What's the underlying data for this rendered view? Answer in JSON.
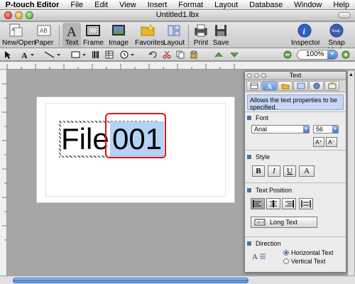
{
  "menubar": {
    "apple_glyph": "",
    "items": [
      "P-touch Editor",
      "File",
      "Edit",
      "View",
      "Insert",
      "Format",
      "Layout",
      "Database",
      "Window",
      "Help"
    ]
  },
  "window": {
    "title": "Untitled1.lbx"
  },
  "toolbar": {
    "new_open": "New/Open",
    "paper": "Paper",
    "text": "Text",
    "frame": "Frame",
    "image": "Image",
    "favorites": "Favorites",
    "layout": "Layout",
    "print": "Print",
    "save": "Save",
    "inspector": "Inspector",
    "snap_mode": "Snap Mode",
    "selected_tool": "Text"
  },
  "secondary_toolbar": {
    "zoom": "100%"
  },
  "canvas": {
    "label_text_word": "File",
    "label_text_number": "001"
  },
  "inspector": {
    "title": "Text",
    "description": "Allows the text properties to be specified.",
    "font_section": "Font",
    "font_name": "Arial",
    "font_size": "56",
    "style_section": "Style",
    "style_buttons": [
      "B",
      "I",
      "U",
      "A"
    ],
    "text_position_section": "Text Position",
    "long_text": "Long Text",
    "direction_section": "Direction",
    "horizontal_text": "Horizontal Text",
    "vertical_text": "Vertical Text"
  },
  "colors": {
    "selection_blue": "#b4d2f4",
    "highlight_red": "#e0141b",
    "panel_accent": "#4f6fb3"
  }
}
